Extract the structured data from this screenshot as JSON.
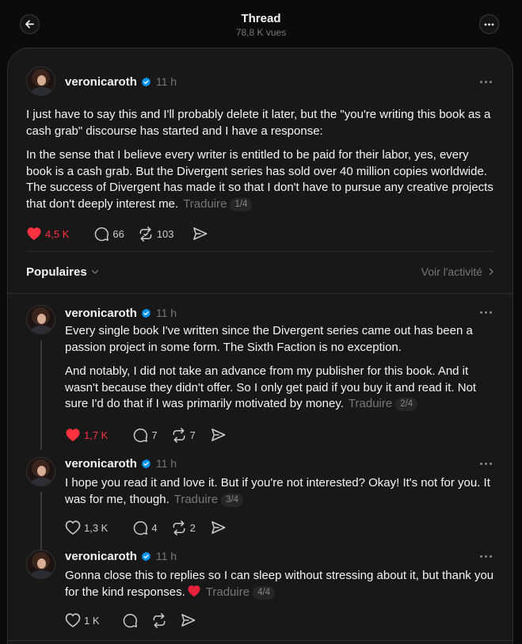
{
  "header": {
    "title": "Thread",
    "views": "78,8 K vues"
  },
  "main_post": {
    "username": "veronicaroth",
    "time": "11 h",
    "paragraph1": "I just have to say this and I'll probably delete it later, but the \"you're writing this book as a cash grab\" discourse has started and I have a response:",
    "paragraph2": "In the sense that I believe every writer is entitled to be paid for their labor, yes, every book is a cash grab. But the Divergent series has sold over 40 million copies worldwide. The success of Divergent has made it so that I don't have to pursue any creative projects that don't deeply interest me.",
    "translate": "Traduire",
    "part": "1/4",
    "likes": "4,5 K",
    "replies": "66",
    "reposts": "103"
  },
  "sort": {
    "label": "Populaires",
    "activity": "Voir l'activité"
  },
  "replies": [
    {
      "username": "veronicaroth",
      "time": "11 h",
      "paragraph1": "Every single book I've written since the Divergent series came out has been a passion project in some form. The Sixth Faction is no exception.",
      "paragraph2": "And notably, I did not take an advance from my publisher for this book. And it wasn't because they didn't offer. So I only get paid if you buy it and read it. Not sure I'd do that if I was primarily motivated by money.",
      "translate": "Traduire",
      "part": "2/4",
      "likes": "1,7 K",
      "replies": "7",
      "reposts": "7"
    },
    {
      "username": "veronicaroth",
      "time": "11 h",
      "paragraph1": "I hope you read it and love it. But if you're not interested? Okay! It's not for you. It was for me, though.",
      "translate": "Traduire",
      "part": "3/4",
      "likes": "1,3 K",
      "replies": "4",
      "reposts": "2"
    },
    {
      "username": "veronicaroth",
      "time": "11 h",
      "paragraph1": "Gonna close this to replies so I can sleep without stressing about it, but thank you for the kind responses.",
      "translate": "Traduire",
      "part": "4/4",
      "likes": "1 K"
    }
  ],
  "colors": {
    "like_active": "#ff3040",
    "verified": "#0095f6",
    "background": "#181818"
  },
  "icons": [
    "back-arrow-icon",
    "more-icon",
    "verified-icon",
    "heart-icon",
    "comment-icon",
    "repost-icon",
    "share-icon",
    "chevron-down-icon",
    "chevron-right-icon"
  ]
}
